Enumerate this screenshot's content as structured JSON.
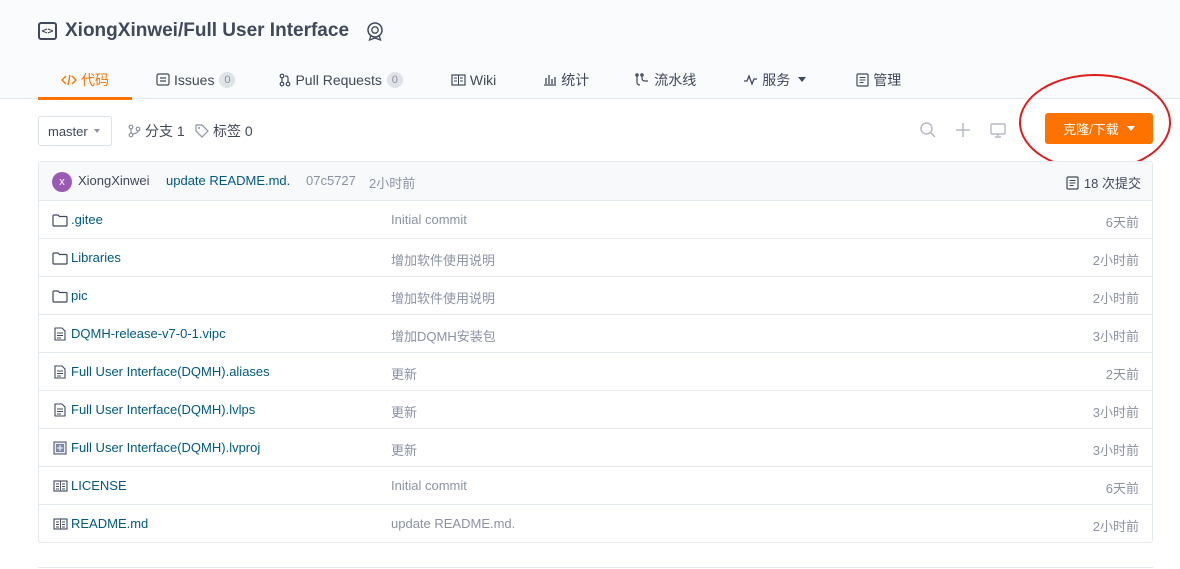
{
  "repo": {
    "name": "XiongXinwei/Full User Interface"
  },
  "tabs": [
    {
      "label": "代码",
      "icon": "code-icon"
    },
    {
      "label": "Issues",
      "count": "0",
      "icon": "issues-icon"
    },
    {
      "label": "Pull Requests",
      "count": "0",
      "icon": "pull-request-icon"
    },
    {
      "label": "Wiki",
      "icon": "wiki-icon"
    },
    {
      "label": "统计",
      "icon": "stats-icon"
    },
    {
      "label": "流水线",
      "icon": "pipeline-icon"
    },
    {
      "label": "服务",
      "icon": "service-icon"
    },
    {
      "label": "管理",
      "icon": "manage-icon"
    }
  ],
  "toolbar": {
    "branch": "master",
    "branches_label": "分支 1",
    "tags_label": "标签 0",
    "clone_label": "克隆/下载"
  },
  "latest_commit": {
    "avatar_letter": "x",
    "author": "XiongXinwei",
    "message": "update README.md.",
    "sha": "07c5727",
    "time": "2小时前",
    "count_label": "18 次提交"
  },
  "files": [
    {
      "name": ".gitee",
      "type": "folder",
      "message": "Initial commit",
      "time": "6天前"
    },
    {
      "name": "Libraries",
      "type": "folder",
      "message": "增加软件使用说明",
      "time": "2小时前"
    },
    {
      "name": "pic",
      "type": "folder",
      "message": "增加软件使用说明",
      "time": "2小时前"
    },
    {
      "name": "DQMH-release-v7-0-1.vipc",
      "type": "file",
      "message": "增加DQMH安装包",
      "time": "3小时前"
    },
    {
      "name": "Full User Interface(DQMH).aliases",
      "type": "file",
      "message": "更新",
      "time": "2天前"
    },
    {
      "name": "Full User Interface(DQMH).lvlps",
      "type": "file",
      "message": "更新",
      "time": "3小时前"
    },
    {
      "name": "Full User Interface(DQMH).lvproj",
      "type": "project",
      "message": "更新",
      "time": "3小时前"
    },
    {
      "name": "LICENSE",
      "type": "book",
      "message": "Initial commit",
      "time": "6天前"
    },
    {
      "name": "README.md",
      "type": "book",
      "message": "update README.md.",
      "time": "2小时前"
    }
  ],
  "colors": {
    "accent": "#fe7300",
    "link": "#005980",
    "annotation": "#e01c1c"
  }
}
